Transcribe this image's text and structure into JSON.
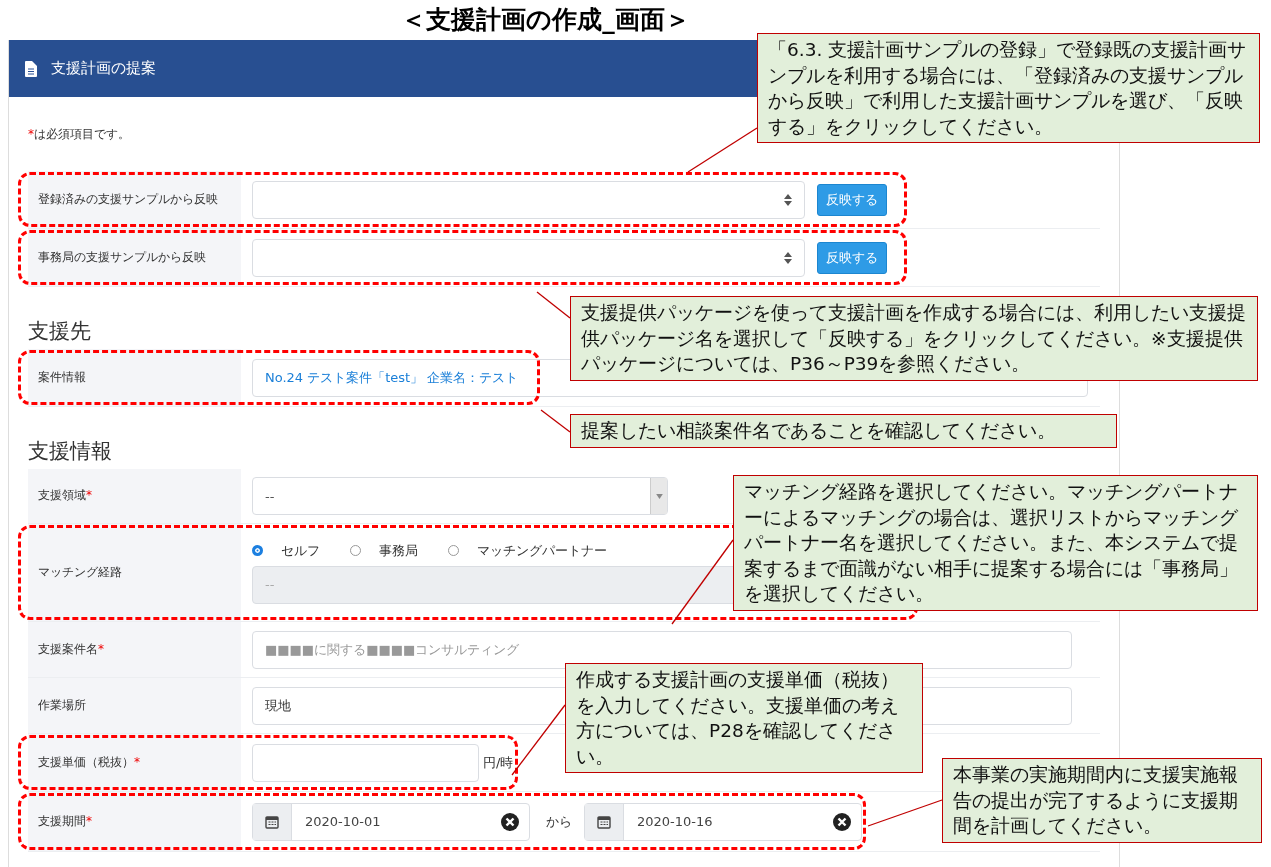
{
  "title": "＜支援計画の作成_画面＞",
  "panel": {
    "header": "支援計画の提案",
    "required_note": {
      "mark": "*",
      "text": "は必須項目です。"
    },
    "sections": [
      {
        "fields": [
          {
            "kind": "select-apply",
            "label": "登録済みの支援サンプルから反映",
            "button": "反映する",
            "highlighted": true
          },
          {
            "kind": "select-apply",
            "label": "事務局の支援サンプルから反映",
            "button": "反映する",
            "highlighted": true
          }
        ]
      },
      {
        "heading": "支援先",
        "fields": [
          {
            "kind": "link-field",
            "label": "案件情報",
            "value": "No.24 テスト案件「test」 企業名：テスト",
            "highlighted": true
          }
        ]
      },
      {
        "heading": "支援情報",
        "fields": [
          {
            "kind": "select",
            "label": "支援領域",
            "required_mark": "*",
            "value": "--",
            "highlighted": false
          },
          {
            "kind": "radio-select",
            "label": "マッチング経路",
            "options": [
              {
                "label": "セルフ",
                "selected": true
              },
              {
                "label": "事務局",
                "selected": false
              },
              {
                "label": "マッチングパートナー",
                "selected": false
              }
            ],
            "value": "--",
            "highlighted": true
          },
          {
            "kind": "text",
            "label": "支援案件名",
            "required_mark": "*",
            "placeholder": "■■■■に関する■■■■コンサルティング",
            "highlighted": false
          },
          {
            "kind": "text",
            "label": "作業場所",
            "value": "現地",
            "highlighted": false
          },
          {
            "kind": "amount",
            "label": "支援単価（税抜）",
            "required_mark": "*",
            "unit": "円/時",
            "highlighted": true
          },
          {
            "kind": "date-range",
            "label": "支援期間",
            "required_mark": "*",
            "start": "2020-10-01",
            "separator": "から",
            "end": "2020-10-16",
            "highlighted": true
          }
        ]
      }
    ]
  },
  "callouts": [
    {
      "text": "「6.3. 支援計画サンプルの登録」で登録既の支援計画サンプルを利用する場合には、「登録済みの支援サンプルから反映」で利用した支援計画サンプルを選び、「反映する」をクリックしてください。"
    },
    {
      "text": "支援提供パッケージを使って支援計画を作成する場合には、利用したい支援提供パッケージ名を選択して「反映する」をクリックしてください。※支援提供パッケージについては、P36～P39を参照ください。"
    },
    {
      "text": "提案したい相談案件名であることを確認してください。"
    },
    {
      "text": "マッチング経路を選択してください。マッチングパートナーによるマッチングの場合は、選択リストからマッチングパートナー名を選択してください。また、本システムで提案するまで面識がない相手に提案する場合には「事務局」を選択してください。"
    },
    {
      "text": "作成する支援計画の支援単価（税抜）を入力してください。支援単価の考え方については、P28を確認してください。"
    },
    {
      "text": "本事業の実施期間内に支援実施報告の提出が完了するように支援期間を計画してください。"
    }
  ]
}
